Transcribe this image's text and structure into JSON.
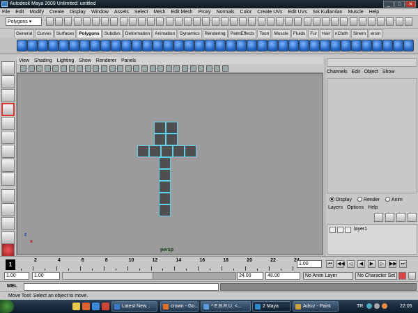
{
  "window": {
    "title": "Autodesk Maya 2009 Unlimited: untitled"
  },
  "menubar": [
    "File",
    "Edit",
    "Modify",
    "Create",
    "Display",
    "Window",
    "Assets",
    "Select",
    "Mesh",
    "Edit Mesh",
    "Proxy",
    "Normals",
    "Color",
    "Create UVs",
    "Edit UVs",
    "Sık Kullanılan",
    "Muscle",
    "Help"
  ],
  "statusline": {
    "mode": "Polygons"
  },
  "shelf_tabs": [
    "General",
    "Curves",
    "Surfaces",
    "Polygons",
    "Subdivs",
    "Deformation",
    "Animation",
    "Dynamics",
    "Rendering",
    "PaintEffects",
    "Toon",
    "Muscle",
    "Fluids",
    "Fur",
    "Hair",
    "nCloth",
    "Sinem",
    "ersin"
  ],
  "shelf_active": "Polygons",
  "panel_menu": [
    "View",
    "Shading",
    "Lighting",
    "Show",
    "Renderer",
    "Panels"
  ],
  "viewport": {
    "camera_label": "persp",
    "axis_z": "z",
    "axis_x": "x"
  },
  "channel_box": {
    "menu": [
      "Channels",
      "Edit",
      "Object",
      "Show"
    ]
  },
  "layer_editor": {
    "modes": [
      {
        "label": "Display",
        "selected": true
      },
      {
        "label": "Render",
        "selected": false
      },
      {
        "label": "Anim",
        "selected": false
      }
    ],
    "menu": [
      "Layers",
      "Options",
      "Help"
    ],
    "layers": [
      "layer1"
    ]
  },
  "time_slider": {
    "current_frame": "1",
    "tick_labels": [
      "2",
      "4",
      "6",
      "8",
      "10",
      "12",
      "14",
      "16",
      "18",
      "20",
      "22",
      "24"
    ],
    "current_time_field": "1.00"
  },
  "range_slider": {
    "start_time": "1.00",
    "playback_start": "1.00",
    "playback_end": "24.00",
    "end_time": "48.00",
    "anim_layer": "No Anim Layer",
    "character_set": "No Character Set"
  },
  "command_line": {
    "label": "MEL"
  },
  "help_line": "Move Tool: Select an object to move.",
  "taskbar": {
    "tasks": [
      {
        "label": "Latest New...",
        "color": "#3a78c8"
      },
      {
        "label": "crown - Go...",
        "color": "#e07020"
      },
      {
        "label": "* E.B.R.U. <...",
        "color": "#5a9ad8"
      },
      {
        "label": "2 Maya",
        "color": "#2a8ad0",
        "active": true
      },
      {
        "label": "Adsız - Paint",
        "color": "#c8a040"
      }
    ],
    "language": "TR",
    "clock": "22:05"
  }
}
